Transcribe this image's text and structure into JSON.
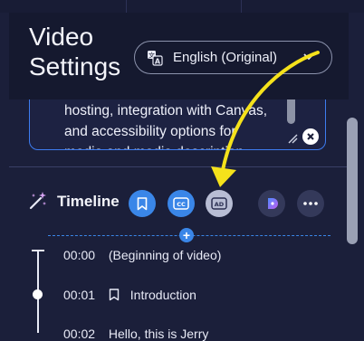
{
  "header": {
    "title_line1": "Video",
    "title_line2": "Settings",
    "language": {
      "value": "English (Original)",
      "icon": "translate-icon"
    }
  },
  "description": {
    "lines": [
      "hosting, integration with Canvas,",
      "and accessibility options for",
      "..."
    ]
  },
  "timeline": {
    "title": "Timeline",
    "toolbar": {
      "bookmark": "bookmark-icon",
      "cc": "CC",
      "ad": "AD",
      "ai": "ai-assistant-icon",
      "more": "more-icon"
    },
    "add_label": "+",
    "items": [
      {
        "time": "00:00",
        "label": "(Beginning of video)",
        "bookmark": false
      },
      {
        "time": "00:01",
        "label": "Introduction",
        "bookmark": true
      },
      {
        "time": "00:02",
        "label": "Hello, this is Jerry",
        "bookmark": false
      }
    ]
  },
  "colors": {
    "background": "#1b1f3a",
    "accent": "#3a86e8",
    "annotation": "#f5e21b"
  }
}
